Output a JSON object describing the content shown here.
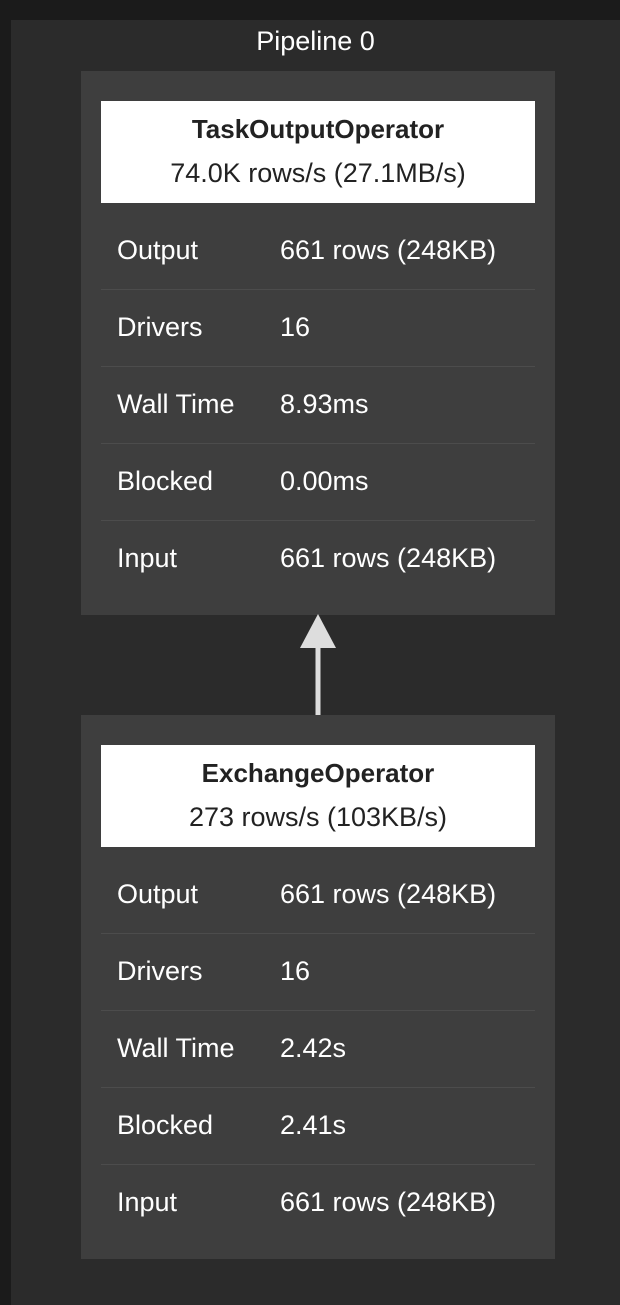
{
  "pipeline": {
    "title": "Pipeline 0",
    "operators": [
      {
        "name": "TaskOutputOperator",
        "rate": "74.0K rows/s (27.1MB/s)",
        "stats": [
          {
            "label": "Output",
            "value": "661 rows (248KB)"
          },
          {
            "label": "Drivers",
            "value": "16"
          },
          {
            "label": "Wall Time",
            "value": "8.93ms"
          },
          {
            "label": "Blocked",
            "value": "0.00ms"
          },
          {
            "label": "Input",
            "value": "661 rows (248KB)"
          }
        ]
      },
      {
        "name": "ExchangeOperator",
        "rate": "273 rows/s (103KB/s)",
        "stats": [
          {
            "label": "Output",
            "value": "661 rows (248KB)"
          },
          {
            "label": "Drivers",
            "value": "16"
          },
          {
            "label": "Wall Time",
            "value": "2.42s"
          },
          {
            "label": "Blocked",
            "value": "2.41s"
          },
          {
            "label": "Input",
            "value": "661 rows (248KB)"
          }
        ]
      }
    ]
  },
  "colors": {
    "page_background": "#1b1b1b",
    "pipeline_background": "#2b2b2b",
    "operator_background": "#3e3e3e",
    "header_background": "#ffffff",
    "edge": "#dddddd"
  },
  "edges": [
    {
      "from": "ExchangeOperator",
      "to": "TaskOutputOperator",
      "icon": "arrow-up-icon"
    }
  ]
}
